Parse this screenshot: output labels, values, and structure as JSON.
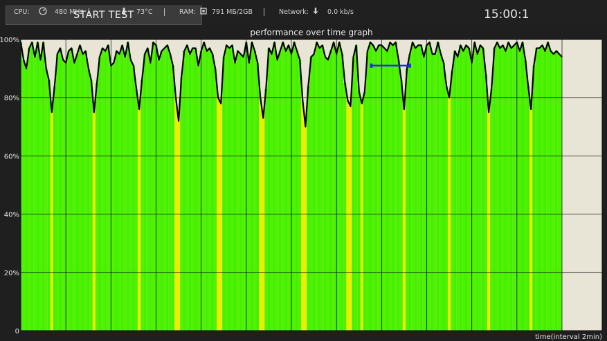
{
  "status": {
    "cpu_label": "CPU:",
    "cpu_value": "480 MHz",
    "temp_value": "73°C",
    "ram_label": "RAM:",
    "ram_value": "791 МБ/2GB",
    "network_label": "Network:",
    "network_value": "0.0 kb/s",
    "icons": [
      "speedometer-icon",
      "thermometer-icon",
      "memory-chip-icon",
      "download-icon"
    ]
  },
  "controls": {
    "start_label": "START TEST",
    "clock": "15:00:1"
  },
  "colors": {
    "plot_background": "#e8e4d6",
    "bar_green": "#3ff200",
    "bar_yellow": "#e8f000",
    "line": "#000000",
    "marker": "#1c2bff",
    "grid": "#000000"
  },
  "chart_data": {
    "type": "area",
    "title": "performance over time graph",
    "xlabel": "time(interval 2min)",
    "ylabel": "",
    "ylim": [
      0,
      100
    ],
    "y_ticks": [
      "0",
      "20%",
      "40%",
      "60%",
      "80%",
      "100%"
    ],
    "grid": true,
    "x_intervals": 12,
    "series": [
      {
        "values": [
          99,
          93,
          90,
          97,
          99,
          94,
          99,
          93,
          99,
          90,
          86,
          75,
          84,
          95,
          97,
          93,
          92,
          96,
          97,
          92,
          95,
          98,
          95,
          96,
          90,
          86,
          75,
          85,
          94,
          97,
          96,
          98,
          91,
          92,
          96,
          95,
          98,
          94,
          99,
          93,
          91,
          83,
          76,
          86,
          95,
          97,
          92,
          99,
          98,
          93,
          96,
          97,
          98,
          95,
          91,
          80,
          72,
          87,
          96,
          98,
          95,
          97,
          97,
          91,
          96,
          99,
          96,
          97,
          95,
          90,
          80,
          78,
          94,
          98,
          97,
          98,
          92,
          96,
          95,
          94,
          99,
          92,
          99,
          96,
          92,
          80,
          73,
          83,
          97,
          95,
          99,
          93,
          96,
          99,
          96,
          98,
          95,
          99,
          96,
          93,
          79,
          70,
          84,
          94,
          95,
          99,
          97,
          98,
          94,
          93,
          96,
          99,
          95,
          99,
          95,
          85,
          79,
          77,
          94,
          98,
          82,
          78,
          82,
          96,
          99,
          98,
          96,
          98,
          98,
          97,
          96,
          99,
          98,
          99,
          93,
          86,
          76,
          90,
          95,
          99,
          97,
          98,
          98,
          94,
          98,
          99,
          95,
          95,
          99,
          95,
          92,
          84,
          80,
          89,
          96,
          94,
          98,
          96,
          98,
          97,
          92,
          99,
          95,
          98,
          97,
          88,
          75,
          83,
          97,
          99,
          97,
          98,
          96,
          99,
          97,
          98,
          99,
          96,
          99,
          93,
          84,
          76,
          91,
          97,
          97,
          98,
          96,
          99,
          96,
          95,
          96,
          95,
          94
        ]
      }
    ],
    "marker": {
      "from": 0.603,
      "to": 0.669,
      "y": 91
    }
  }
}
